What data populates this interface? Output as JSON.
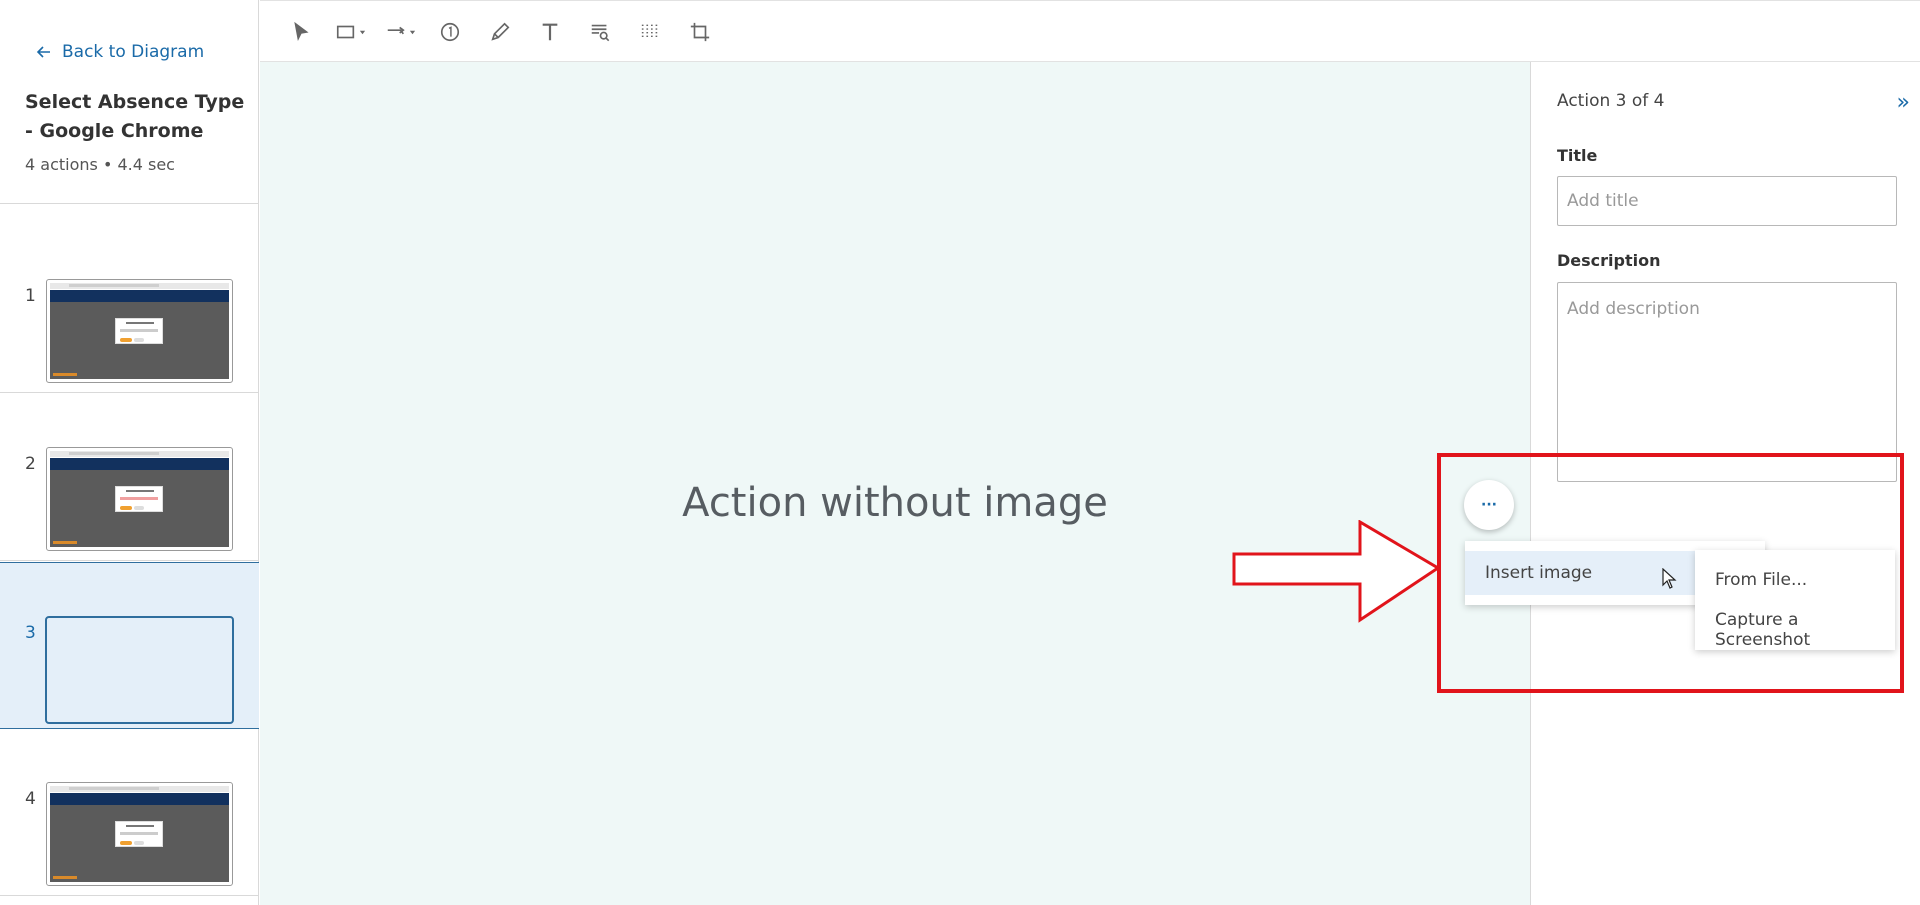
{
  "sidebar": {
    "back_label": "Back to Diagram",
    "title": "Select Absence Type - Google Chrome",
    "meta": "4 actions • 4.4 sec",
    "steps": [
      {
        "number": "1"
      },
      {
        "number": "2"
      },
      {
        "number": "3"
      },
      {
        "number": "4"
      }
    ]
  },
  "toolbar": {
    "tools": [
      "pointer-icon",
      "rectangle-icon",
      "arrow-icon",
      "numbered-callout-icon",
      "pen-icon",
      "text-icon",
      "magnifier-icon",
      "blur-icon",
      "crop-icon"
    ]
  },
  "canvas": {
    "empty_message": "Action without image"
  },
  "panel": {
    "action_counter": "Action 3 of 4",
    "title_label": "Title",
    "title_placeholder": "Add title",
    "description_label": "Description",
    "description_placeholder": "Add description"
  },
  "context_menu": {
    "more_label": "···",
    "insert_image_label": "Insert image",
    "submenu": {
      "from_file": "From File...",
      "capture_screenshot": "Capture a Screenshot"
    }
  },
  "colors": {
    "accent": "#1a6aa8",
    "highlight": "#e1141b",
    "canvas_bg": "#eff8f7",
    "active_step_bg": "#e4eff9"
  }
}
